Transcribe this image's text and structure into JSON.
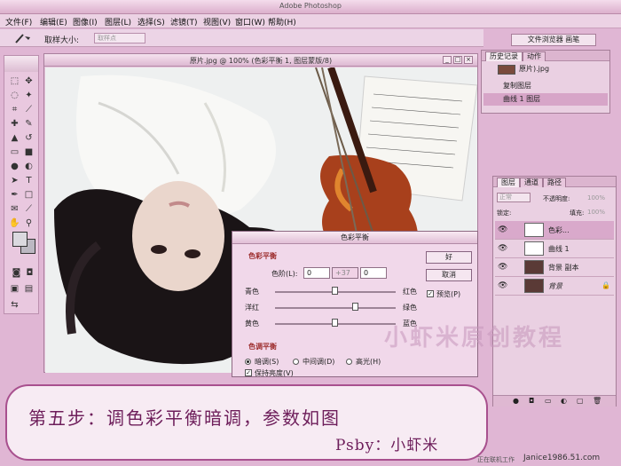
{
  "app": {
    "title": "Adobe Photoshop"
  },
  "menu": [
    "文件(F)",
    "编辑(E)",
    "图像(I)",
    "图层(L)",
    "选择(S)",
    "滤镜(T)",
    "视图(V)",
    "窗口(W)",
    "帮助(H)"
  ],
  "options": {
    "sample_label": "取样大小:",
    "sample_value": "取样点",
    "browser_button": "文件浏览器 画笔"
  },
  "document": {
    "title": "原片.jpg @ 100% (色彩平衡 1, 图层蒙版/8)"
  },
  "history_panel": {
    "tabs": [
      "历史记录",
      "动作"
    ],
    "snapshot": "原片).jpg",
    "items": [
      "复制图层",
      "曲线 1 图层"
    ]
  },
  "layers_panel": {
    "tabs": [
      "图层",
      "通道",
      "路径"
    ],
    "blend_mode": "正常",
    "opacity_label": "不透明度:",
    "opacity_value": "100%",
    "lock_label": "锁定:",
    "fill_label": "填充:",
    "fill_value": "100%",
    "layers": [
      "色彩...",
      "曲线 1",
      "背景 副本",
      "背景"
    ]
  },
  "dialog": {
    "title": "色彩平衡",
    "balance_group": "色彩平衡",
    "levels_label": "色阶(L):",
    "levels": [
      "0",
      "+37",
      "0"
    ],
    "sliders": [
      {
        "left": "青色",
        "right": "红色",
        "pos": 0.5
      },
      {
        "left": "洋红",
        "right": "绿色",
        "pos": 0.67
      },
      {
        "left": "黄色",
        "right": "蓝色",
        "pos": 0.5
      }
    ],
    "tone_group": "色调平衡",
    "tones": [
      "暗调(S)",
      "中间调(D)",
      "高光(H)"
    ],
    "preserve_luminosity": "保持亮度(V)",
    "ok": "好",
    "cancel": "取消",
    "preview": "预览(P)"
  },
  "caption": {
    "main": "第五步：调色彩平衡暗调，参数如图",
    "by": "Psby：小虾米"
  },
  "watermark": "小虾米原创教程",
  "status_text": "正在联机工作",
  "url": "Janice1986.51.com"
}
